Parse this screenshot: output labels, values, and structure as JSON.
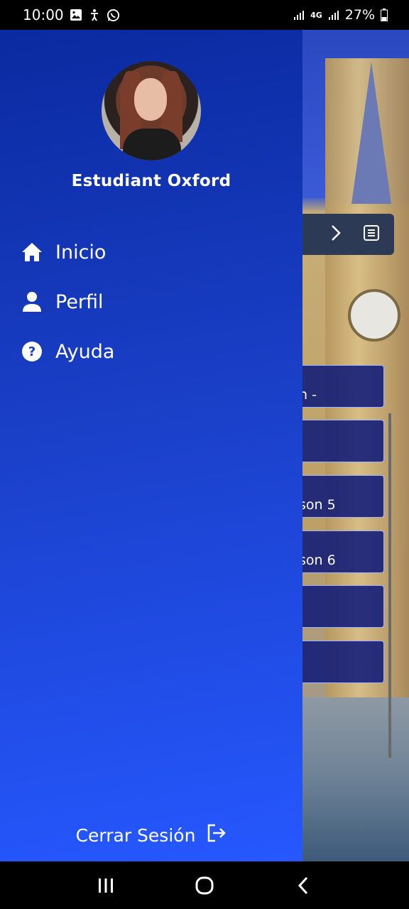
{
  "status_bar": {
    "time": "10:00",
    "battery_pct": "27%",
    "network": "4G",
    "notification_icons": [
      "image-icon",
      "accessibility-icon",
      "whatsapp-icon"
    ]
  },
  "drawer": {
    "user_name": "Estudiant Oxford",
    "menu": [
      {
        "label": "Inicio",
        "icon": "home-icon"
      },
      {
        "label": "Perfil",
        "icon": "person-icon"
      },
      {
        "label": "Ayuda",
        "icon": "help-circle-icon"
      }
    ],
    "logout_label": "Cerrar Sesión",
    "colors": {
      "top": "#0a2aa0",
      "bottom": "#2658ff"
    }
  },
  "background_app": {
    "cards": [
      {
        "text": "n -"
      },
      {
        "text": ""
      },
      {
        "text": "son 5"
      },
      {
        "text": "son 6"
      },
      {
        "text": ""
      },
      {
        "text": ""
      }
    ]
  },
  "nav_bar": {
    "buttons": [
      "recent-apps-icon",
      "home-button-icon",
      "back-icon"
    ]
  }
}
